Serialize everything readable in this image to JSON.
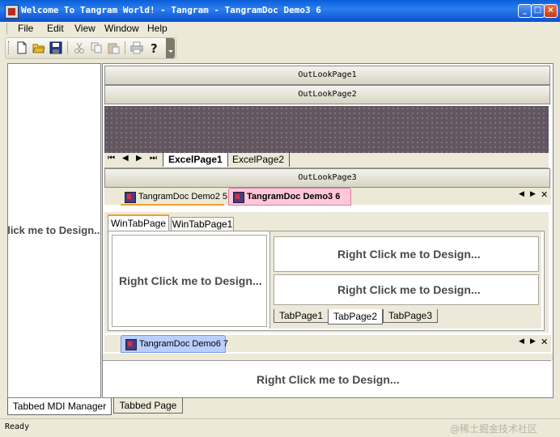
{
  "window": {
    "title": "Welcome To Tangram World! - Tangram - TangramDoc Demo3 6",
    "minimize": "_",
    "maximize": "□",
    "close": "×"
  },
  "menu": {
    "file": "File",
    "edit": "Edit",
    "view": "View",
    "window": "Window",
    "help": "Help"
  },
  "left_pane": {
    "text": "Right Click me to Design..."
  },
  "outlook": {
    "page1": "OutLookPage1",
    "page2": "OutLookPage2",
    "page3": "OutLookPage3"
  },
  "excel_tabs": {
    "nav_first": "⏮",
    "nav_prev": "◀",
    "nav_next": "▶",
    "nav_last": "⏭",
    "tab1": "ExcelPage1",
    "tab2": "ExcelPage2"
  },
  "mdi_tabs_top": {
    "tab1": "TangramDoc Demo2 5",
    "tab2": "TangramDoc Demo3 6",
    "nav_prev": "◀",
    "nav_next": "▶",
    "close": "✕"
  },
  "win_tabs": {
    "tab1": "WinTabPage",
    "tab2": "WinTabPage1"
  },
  "panels": {
    "left": "Right Click me to Design...",
    "right_top": "Right Click me to Design...",
    "right_bottom": "Right Click me to Design..."
  },
  "tab_pages": {
    "tab1": "TabPage1",
    "tab2": "TabPage2",
    "tab3": "TabPage3"
  },
  "mdi_tabs_bottom": {
    "tab1": "TangramDoc Demo6 7",
    "nav_prev": "◀",
    "nav_next": "▶",
    "close": "✕"
  },
  "bottom_panel": {
    "text": "Right Click me to Design..."
  },
  "bottom_tabs": {
    "tab1": "Tabbed MDI Manager",
    "tab2": "Tabbed Page"
  },
  "status": {
    "text": "Ready",
    "watermark": "@稀土掘金技术社区"
  },
  "colors": {
    "title_bar": "#0a5fd8",
    "grid_bg": "#625661",
    "active_tab": "#ffc8d8",
    "blue_tab": "#b8cfff",
    "frame": "#ece9d8"
  }
}
